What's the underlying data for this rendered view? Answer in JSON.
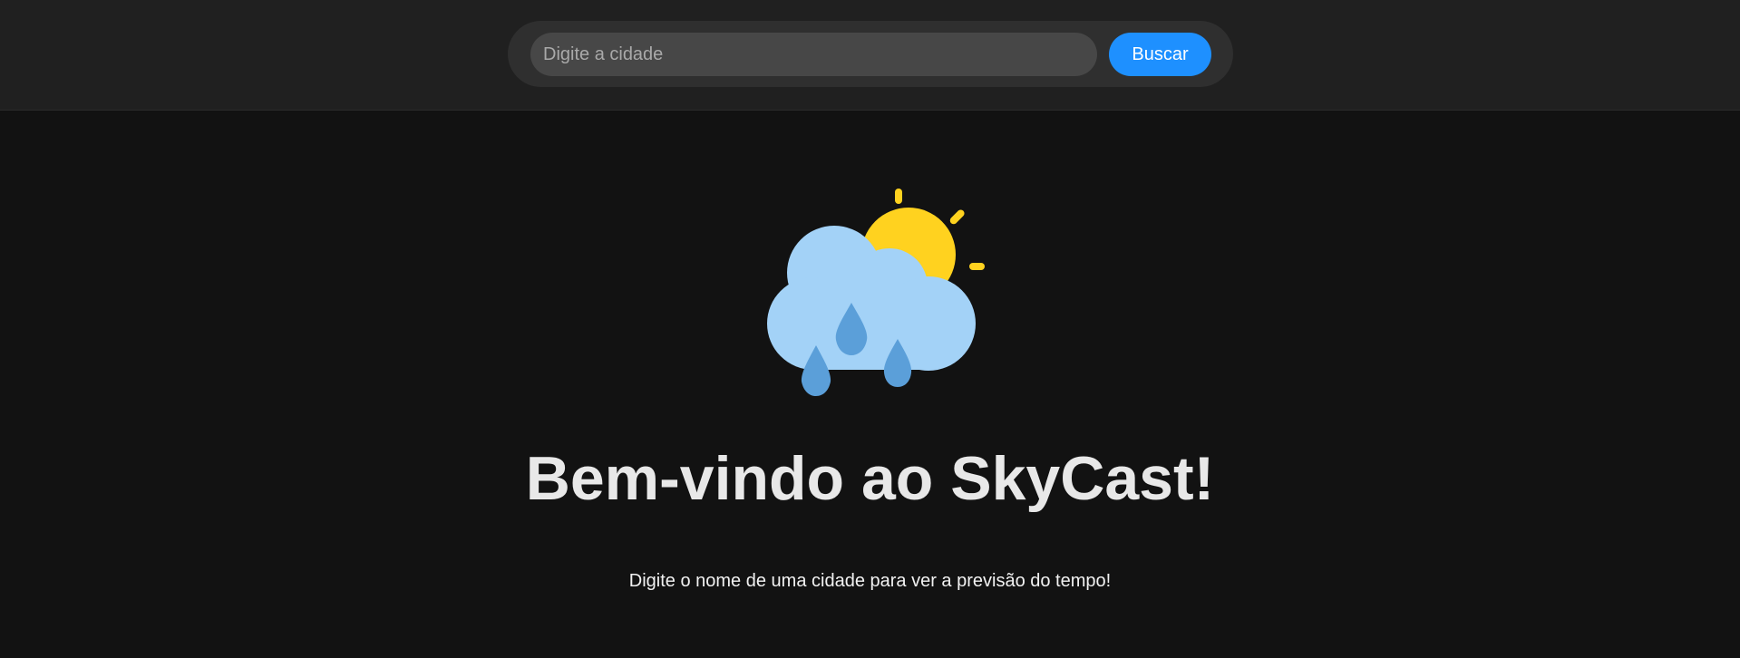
{
  "header": {
    "search": {
      "placeholder": "Digite a cidade",
      "value": ""
    },
    "search_button_label": "Buscar"
  },
  "hero": {
    "icon": "sun-cloud-rain-icon",
    "title": "Bem-vindo ao SkyCast!",
    "subtitle": "Digite o nome de uma cidade para ver a previsão do tempo!"
  },
  "colors": {
    "page_background": "#121212",
    "header_background": "#202020",
    "search_pill": "#2f2f2f",
    "search_input": "#474747",
    "accent_button": "#1e90ff",
    "sun": "#ffd21f",
    "cloud": "#a3d2f7",
    "raindrop": "#5b9fd9"
  }
}
